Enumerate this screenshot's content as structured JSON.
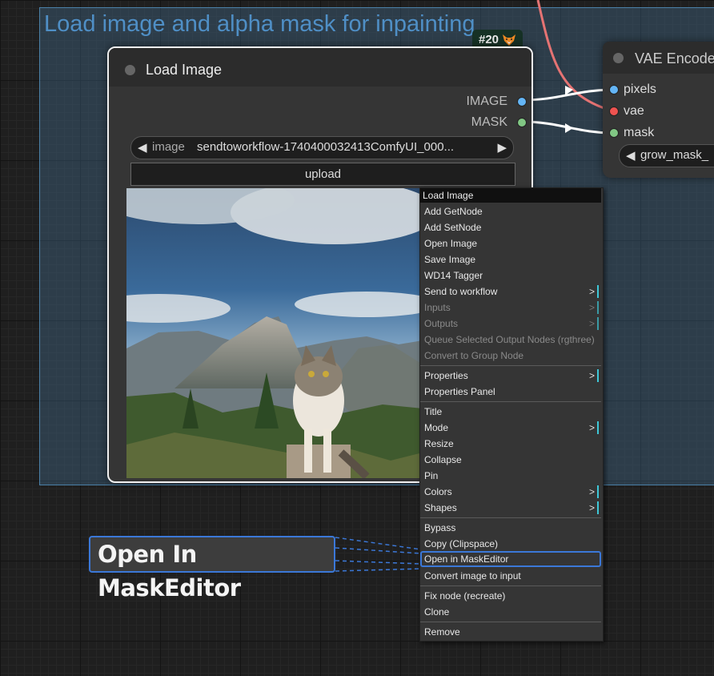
{
  "group": {
    "title": "Load image and alpha mask for inpainting",
    "badge": "#20"
  },
  "load_node": {
    "title": "Load Image",
    "outputs": [
      {
        "label": "IMAGE",
        "color": "#64b5f6"
      },
      {
        "label": "MASK",
        "color": "#81c784"
      }
    ],
    "image_widget": {
      "label": "image",
      "value": "sendtoworkflow-1740400032413ComfyUI_000...",
      "left_arrow": "◀",
      "right_arrow": "▶"
    },
    "upload_label": "upload"
  },
  "vae_node": {
    "title": "VAE Encode",
    "inputs": [
      {
        "label": "pixels",
        "color": "#64b5f6"
      },
      {
        "label": "vae",
        "color": "#ef5350"
      },
      {
        "label": "mask",
        "color": "#81c784"
      }
    ],
    "widget_value": "grow_mask_"
  },
  "context_menu": {
    "header": "Load Image",
    "items": [
      {
        "label": "Add GetNode"
      },
      {
        "label": "Add SetNode"
      },
      {
        "label": "Open Image"
      },
      {
        "label": "Save Image"
      },
      {
        "label": "WD14 Tagger"
      },
      {
        "label": "Send to workflow",
        "submenu": true
      },
      {
        "label": "Inputs",
        "submenu": true,
        "disabled": true
      },
      {
        "label": "Outputs",
        "submenu": true,
        "disabled": true
      },
      {
        "label": "Queue Selected Output Nodes (rgthree)",
        "disabled": true
      },
      {
        "label": "Convert to Group Node",
        "disabled": true
      },
      {
        "label": "Properties",
        "submenu": true
      },
      {
        "label": "Properties Panel"
      },
      {
        "label": "Title"
      },
      {
        "label": "Mode",
        "submenu": true
      },
      {
        "label": "Resize"
      },
      {
        "label": "Collapse"
      },
      {
        "label": "Pin"
      },
      {
        "label": "Colors",
        "submenu": true
      },
      {
        "label": "Shapes",
        "submenu": true
      },
      {
        "label": "Bypass"
      },
      {
        "label": "Copy (Clipspace)"
      },
      {
        "label": "Open in MaskEditor",
        "highlight": true
      },
      {
        "label": "Convert image to input"
      },
      {
        "label": "Fix node (recreate)"
      },
      {
        "label": "Clone"
      },
      {
        "label": "Remove"
      }
    ],
    "submenu_arrow": ">"
  },
  "callout": {
    "label": "Open In MaskEditor"
  },
  "colors": {
    "accent": "#3b78d8",
    "link_vae": "#e57373"
  }
}
